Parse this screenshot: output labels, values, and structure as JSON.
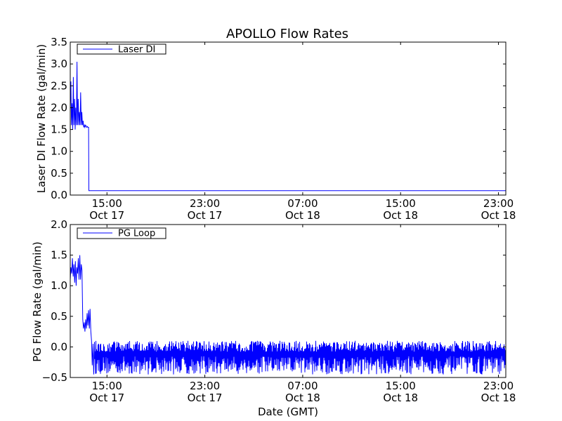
{
  "title": "APOLLO Flow Rates",
  "xlabel": "Date (GMT)",
  "x_ticks": [
    {
      "time": "15:00",
      "date": "Oct 17"
    },
    {
      "time": "23:00",
      "date": "Oct 17"
    },
    {
      "time": "07:00",
      "date": "Oct 18"
    },
    {
      "time": "15:00",
      "date": "Oct 18"
    },
    {
      "time": "23:00",
      "date": "Oct 18"
    }
  ],
  "colors": {
    "series": "#0000ff",
    "axes": "#000000",
    "background": "#ffffff"
  },
  "chart_data": [
    {
      "type": "line",
      "title": "APOLLO Flow Rates",
      "ylabel": "Laser DI Flow Rate (gal/min)",
      "ylim": [
        0,
        3.5
      ],
      "yticks": [
        "0.0",
        "0.5",
        "1.0",
        "1.5",
        "2.0",
        "2.5",
        "3.0",
        "3.5"
      ],
      "xlim_hours": [
        12.0,
        23.6
      ],
      "legend": {
        "placement": "top-left",
        "entries": [
          "Laser DI"
        ]
      },
      "grid": false,
      "series": [
        {
          "name": "Laser DI",
          "x_hours": [
            12.0,
            12.05,
            12.1,
            12.15,
            12.2,
            12.25,
            12.3,
            12.35,
            12.4,
            12.45,
            12.5,
            12.55,
            12.6,
            12.65,
            12.7,
            12.75,
            12.8,
            12.85,
            12.9,
            12.95,
            13.0,
            13.05,
            13.1,
            13.15,
            13.2,
            13.25,
            13.3,
            13.35,
            13.4,
            13.45,
            13.5,
            13.52,
            13.54,
            20.0,
            30.0,
            40.0,
            47.6
          ],
          "values": [
            2.0,
            2.6,
            1.6,
            2.1,
            1.5,
            2.7,
            1.6,
            2.2,
            1.5,
            2.0,
            1.6,
            3.05,
            1.6,
            2.2,
            1.6,
            1.9,
            1.6,
            2.35,
            1.6,
            1.9,
            1.6,
            1.7,
            1.55,
            1.6,
            1.55,
            1.6,
            1.58,
            1.55,
            1.57,
            1.55,
            1.55,
            0.1,
            0.1,
            0.1,
            0.1,
            0.1,
            0.1
          ]
        }
      ]
    },
    {
      "type": "line",
      "ylabel": "PG Flow Rate (gal/min)",
      "ylim": [
        -0.5,
        2.0
      ],
      "yticks": [
        "−0.5",
        "0.0",
        "0.5",
        "1.0",
        "1.5",
        "2.0"
      ],
      "legend": {
        "placement": "top-left",
        "entries": [
          "PG Loop"
        ]
      },
      "grid": false,
      "series": [
        {
          "name": "PG Loop",
          "x_hours": [
            12.0,
            12.06,
            12.12,
            12.18,
            12.24,
            12.3,
            12.36,
            12.42,
            12.48,
            12.54,
            12.6,
            12.66,
            12.72,
            12.78,
            12.84,
            12.9,
            12.96,
            13.02,
            13.08,
            13.14,
            13.2,
            13.26,
            13.32,
            13.38,
            13.44,
            13.5,
            13.56,
            13.62,
            13.68,
            13.74,
            13.8,
            13.86,
            13.92,
            13.98
          ],
          "values": [
            1.1,
            1.3,
            1.2,
            1.45,
            1.15,
            1.35,
            1.05,
            1.4,
            1.0,
            1.3,
            1.2,
            1.45,
            1.1,
            1.5,
            1.1,
            1.35,
            1.25,
            0.45,
            0.3,
            0.4,
            0.25,
            0.45,
            0.3,
            0.55,
            0.35,
            0.6,
            0.3,
            0.62,
            0.25,
            0.1,
            -0.3,
            0.05,
            -0.45,
            0.08
          ]
        }
      ],
      "noise_band": {
        "x_hours": [
          13.98,
          47.6
        ],
        "upper": 0.1,
        "lower": -0.45,
        "typical_mean": -0.15
      }
    }
  ]
}
